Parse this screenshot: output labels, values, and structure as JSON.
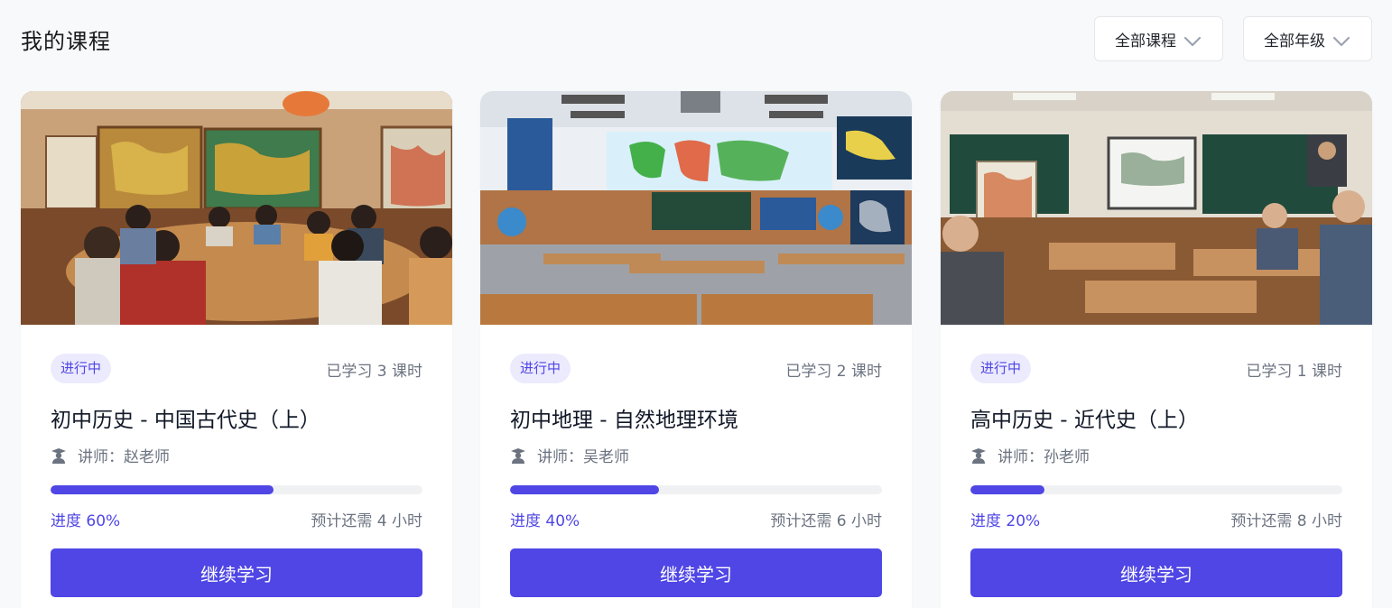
{
  "header": {
    "title": "我的课程"
  },
  "filters": {
    "course": {
      "label": "全部课程"
    },
    "grade": {
      "label": "全部年级"
    }
  },
  "colors": {
    "accent": "#4f46e5",
    "badge_bg": "#eceafd",
    "page_bg": "#f8f9fb"
  },
  "icons": {
    "chevron": "chevron-down-icon",
    "teacher": "teacher-icon"
  },
  "courses": [
    {
      "status": "进行中",
      "learned": "已学习 3 课时",
      "title": "初中历史 - 中国古代史（上）",
      "teacher": "讲师：赵老师",
      "progress": 0.6,
      "progress_text": "进度 60%",
      "remaining": "预计还需 4 小时",
      "cta": "继续学习",
      "cover": "history-classroom-image"
    },
    {
      "status": "进行中",
      "learned": "已学习 2 课时",
      "title": "初中地理 - 自然地理环境",
      "teacher": "讲师：吴老师",
      "progress": 0.4,
      "progress_text": "进度 40%",
      "remaining": "预计还需 6 小时",
      "cta": "继续学习",
      "cover": "geography-classroom-image"
    },
    {
      "status": "进行中",
      "learned": "已学习 1 课时",
      "title": "高中历史 - 近代史（上）",
      "teacher": "讲师：孙老师",
      "progress": 0.2,
      "progress_text": "进度 20%",
      "remaining": "预计还需 8 小时",
      "cta": "继续学习",
      "cover": "modern-history-classroom-image"
    }
  ]
}
